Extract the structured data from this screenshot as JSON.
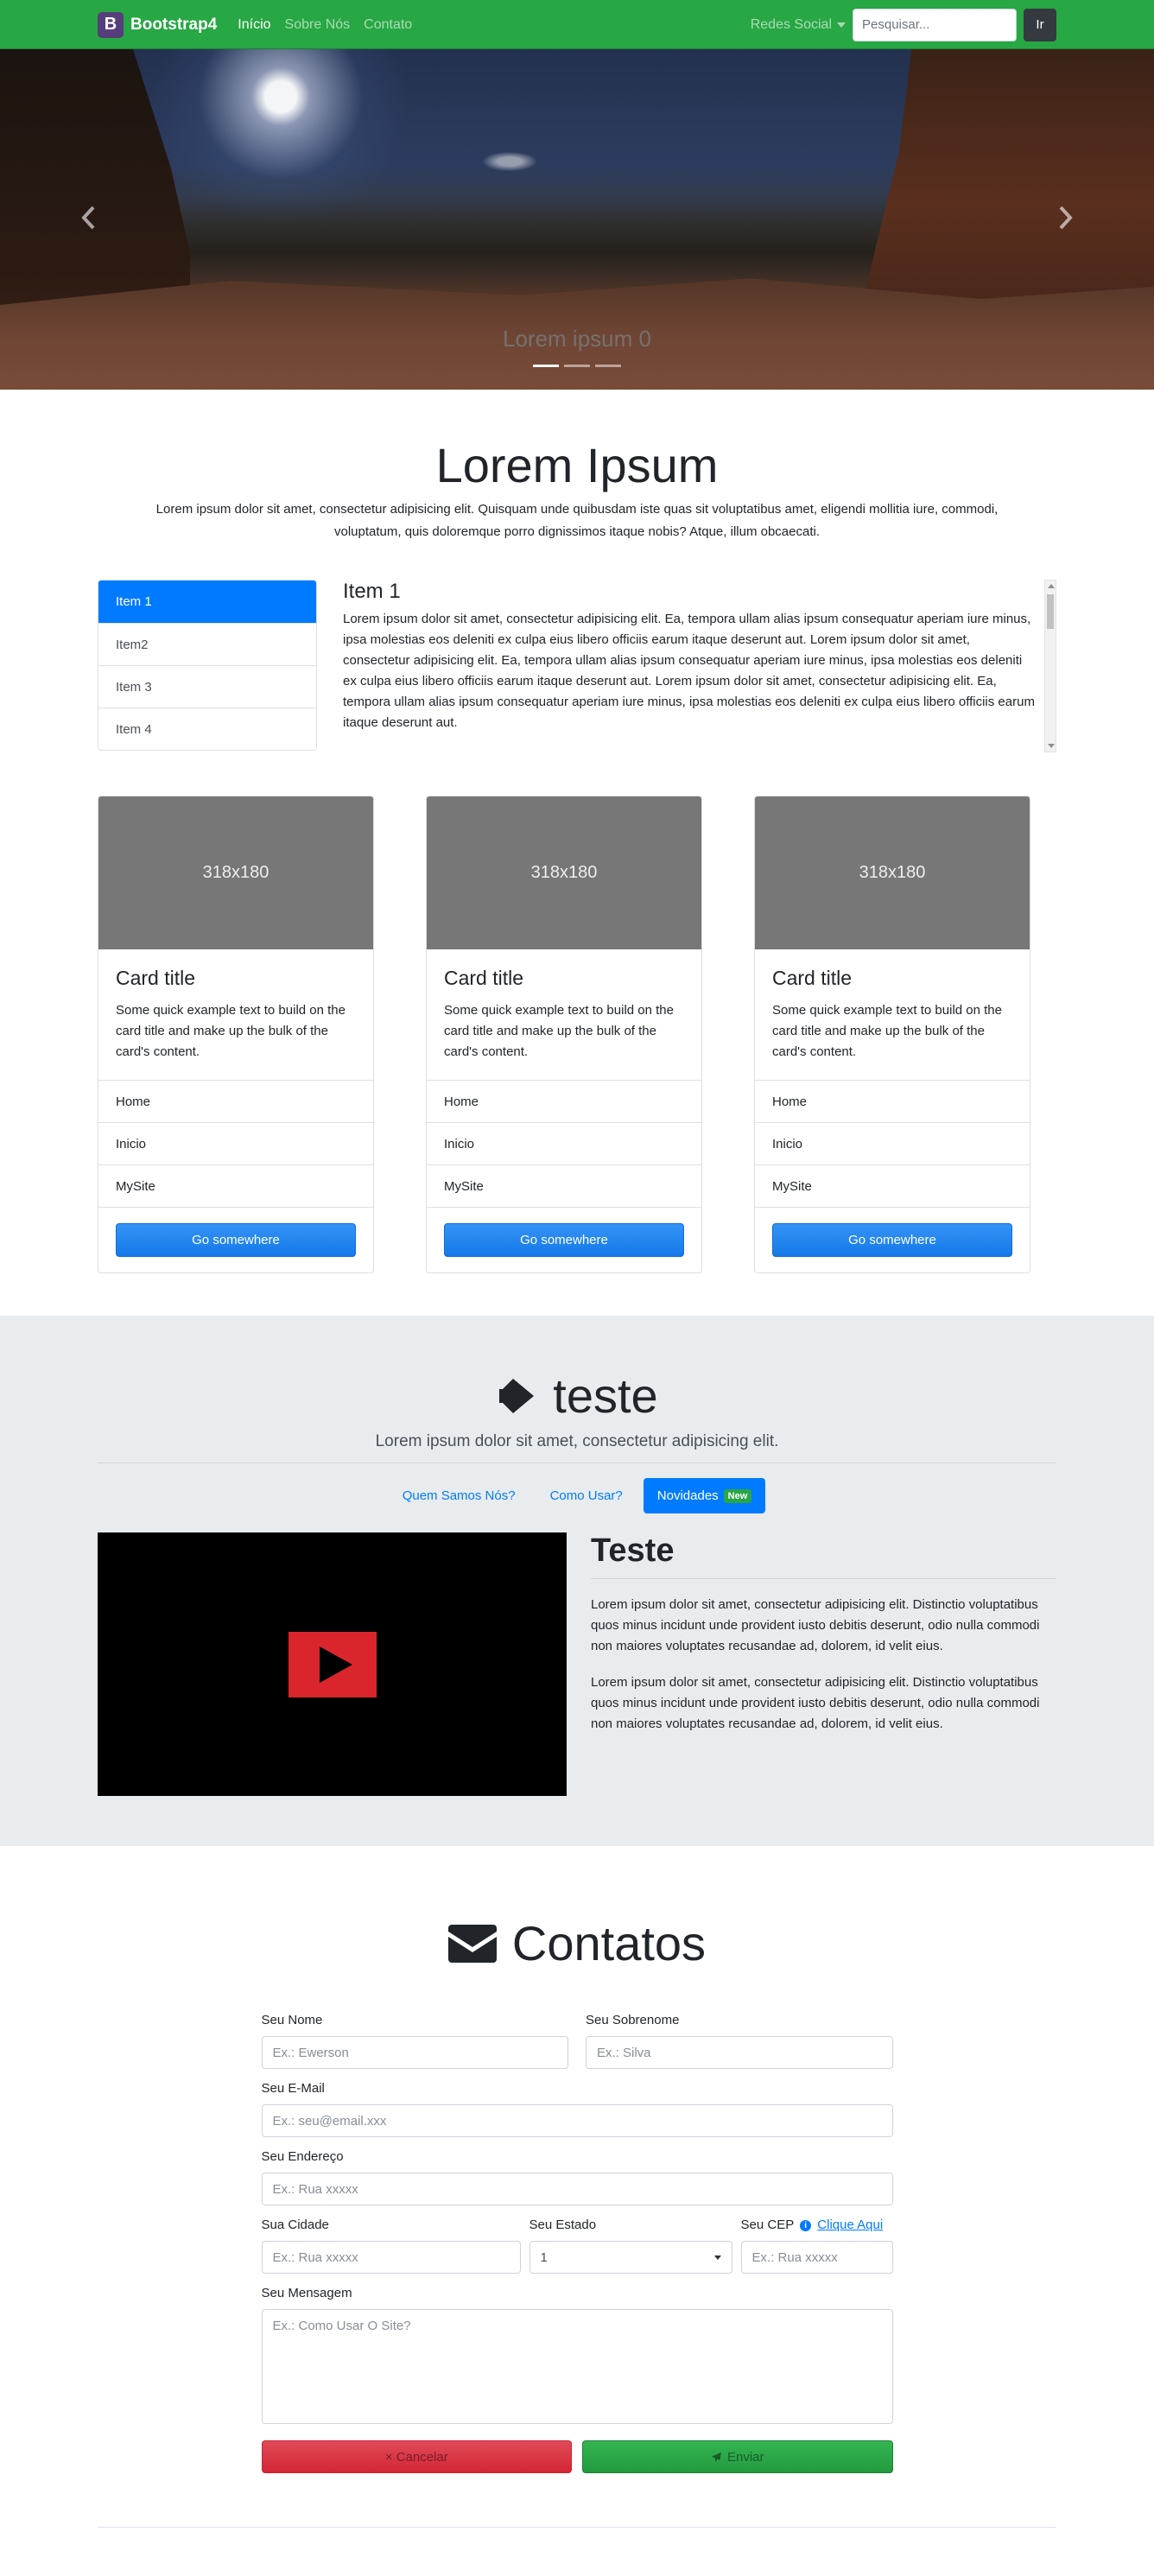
{
  "navbar": {
    "brand_logo": "B",
    "brand": "Bootstrap4",
    "links": [
      "Início",
      "Sobre Nós",
      "Contato"
    ],
    "dropdown": "Redes Social",
    "search_placeholder": "Pesquisar...",
    "search_button": "Ir"
  },
  "carousel": {
    "caption": "Lorem ipsum 0",
    "prev_icon": "chevron-left-icon",
    "next_icon": "chevron-right-icon",
    "indicator_count": 3,
    "active_index": 0
  },
  "intro": {
    "title": "Lorem Ipsum",
    "text": "Lorem ipsum dolor sit amet, consectetur adipisicing elit. Quisquam unde quibusdam iste quas sit voluptatibus amet, eligendi mollitia iure, commodi, voluptatum, quis doloremque porro dignissimos itaque nobis? Atque, illum obcaecati."
  },
  "list": {
    "items": [
      "Item 1",
      "Item2",
      "Item 3",
      "Item 4"
    ],
    "active_index": 0,
    "content_title": "Item 1",
    "content_text": "Lorem ipsum dolor sit amet, consectetur adipisicing elit. Ea, tempora ullam alias ipsum consequatur aperiam iure minus, ipsa molestias eos deleniti ex culpa eius libero officiis earum itaque deserunt aut. Lorem ipsum dolor sit amet, consectetur adipisicing elit. Ea, tempora ullam alias ipsum consequatur aperiam iure minus, ipsa molestias eos deleniti ex culpa eius libero officiis earum itaque deserunt aut. Lorem ipsum dolor sit amet, consectetur adipisicing elit. Ea, tempora ullam alias ipsum consequatur aperiam iure minus, ipsa molestias eos deleniti ex culpa eius libero officiis earum itaque deserunt aut."
  },
  "cards": [
    {
      "image": "318x180",
      "title": "Card title",
      "text": "Some quick example text to build on the card title and make up the bulk of the card's content.",
      "links": [
        "Home",
        "Inicio",
        "MySite"
      ],
      "button": "Go somewhere"
    },
    {
      "image": "318x180",
      "title": "Card title",
      "text": "Some quick example text to build on the card title and make up the bulk of the card's content.",
      "links": [
        "Home",
        "Inicio",
        "MySite"
      ],
      "button": "Go somewhere"
    },
    {
      "image": "318x180",
      "title": "Card title",
      "text": "Some quick example text to build on the card title and make up the bulk of the card's content.",
      "links": [
        "Home",
        "Inicio",
        "MySite"
      ],
      "button": "Go somewhere"
    }
  ],
  "teste": {
    "title": "teste",
    "title_icon": "arrow-right-icon",
    "lead": "Lorem ipsum dolor sit amet, consectetur adipisicing elit.",
    "pills": [
      "Quem Samos Nós?",
      "Como Usar?",
      "Novidades"
    ],
    "badge": "New",
    "active_pill": 2,
    "video_icon": "play-icon",
    "heading": "Teste",
    "paragraphs": [
      "Lorem ipsum dolor sit amet, consectetur adipisicing elit. Distinctio voluptatibus quos minus incidunt unde provident iusto debitis deserunt, odio nulla commodi non maiores voluptates recusandae ad, dolorem, id velit eius.",
      "Lorem ipsum dolor sit amet, consectetur adipisicing elit. Distinctio voluptatibus quos minus incidunt unde provident iusto debitis deserunt, odio nulla commodi non maiores voluptates recusandae ad, dolorem, id velit eius."
    ]
  },
  "contact": {
    "title": "Contatos",
    "title_icon": "envelope-icon",
    "labels": {
      "nome": "Seu Nome",
      "sobrenome": "Seu Sobrenome",
      "email": "Seu E-Mail",
      "endereco": "Seu Endereço",
      "cidade": "Sua Cidade",
      "estado": "Seu Estado",
      "cep": "Seu CEP",
      "cep_link": "Clique Aqui",
      "mensagem": "Seu Mensagem"
    },
    "placeholders": {
      "nome": "Ex.: Ewerson",
      "sobrenome": "Ex.: Silva",
      "email": "Ex.: seu@email.xxx",
      "endereco": "Ex.: Rua xxxxx",
      "cidade": "Ex.: Rua xxxxx",
      "cep": "Ex.: Rua xxxxx",
      "mensagem": "Ex.: Como Usar O Site?"
    },
    "estado_value": "1",
    "cancel_button": "× Cancelar",
    "send_button": "Enviar"
  },
  "colors": {
    "navbar": "#28a745",
    "primary": "#007bff",
    "danger": "#dc3545",
    "gray_section": "#e9ecef"
  }
}
